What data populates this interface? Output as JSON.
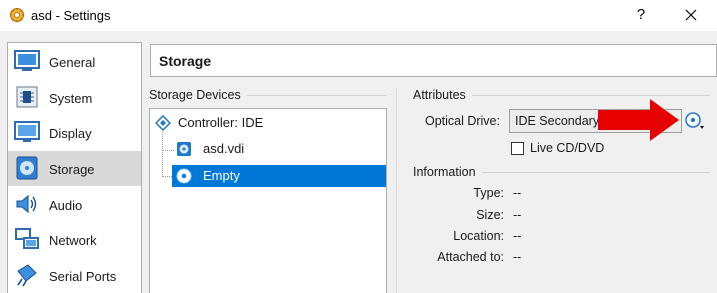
{
  "window": {
    "title": "asd - Settings",
    "help_glyph": "?",
    "close_icon": "close-icon"
  },
  "sidebar": {
    "items": [
      {
        "label": "General",
        "icon": "general-icon"
      },
      {
        "label": "System",
        "icon": "system-icon"
      },
      {
        "label": "Display",
        "icon": "display-icon"
      },
      {
        "label": "Storage",
        "icon": "storage-icon",
        "selected": true
      },
      {
        "label": "Audio",
        "icon": "audio-icon"
      },
      {
        "label": "Network",
        "icon": "network-icon"
      },
      {
        "label": "Serial Ports",
        "icon": "serial-ports-icon"
      }
    ]
  },
  "page": {
    "title": "Storage"
  },
  "storage_devices": {
    "label": "Storage Devices",
    "controller": "Controller: IDE",
    "items": [
      {
        "label": "asd.vdi",
        "icon": "hard-disk-icon"
      },
      {
        "label": "Empty",
        "icon": "optical-disc-icon",
        "selected": true
      }
    ]
  },
  "attributes": {
    "label": "Attributes",
    "optical_drive_label": "Optical Drive:",
    "optical_drive_value": "IDE Secondary M",
    "live_cd_label": "Live CD/DVD",
    "live_cd_checked": false
  },
  "information": {
    "label": "Information",
    "rows": [
      {
        "label": "Type:",
        "value": "--"
      },
      {
        "label": "Size:",
        "value": "--"
      },
      {
        "label": "Location:",
        "value": "--"
      },
      {
        "label": "Attached to:",
        "value": "--"
      }
    ]
  },
  "colors": {
    "selection": "#0078d7",
    "annotation_arrow": "#e60000",
    "accent_blue": "#1f78c8"
  }
}
